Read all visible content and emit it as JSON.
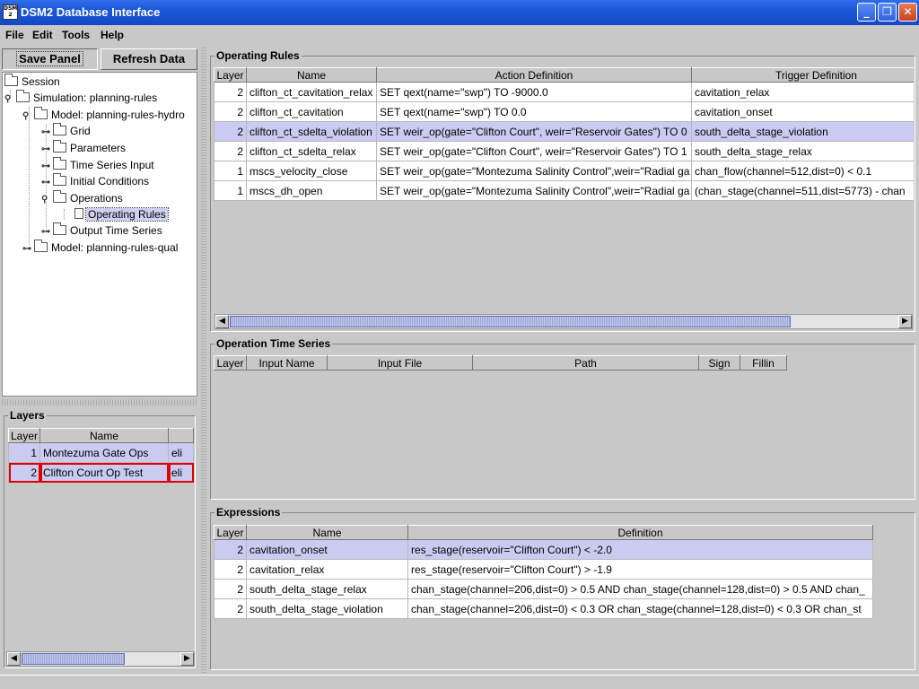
{
  "window": {
    "title": "DSM2 Database Interface",
    "icon_text": "DSM 2"
  },
  "menu": [
    "File",
    "Edit",
    "Tools",
    "Help"
  ],
  "toolbar": {
    "save_label": "Save Panel",
    "refresh_label": "Refresh Data"
  },
  "tree": {
    "session": "Session",
    "simulation": "Simulation: planning-rules",
    "model_hydro": "Model: planning-rules-hydro",
    "grid": "Grid",
    "parameters": "Parameters",
    "time_series_input": "Time Series Input",
    "initial_conditions": "Initial Conditions",
    "operations": "Operations",
    "operating_rules": "Operating Rules",
    "output_time_series": "Output Time Series",
    "model_qual": "Model: planning-rules-qual"
  },
  "layers": {
    "title": "Layers",
    "columns": [
      "Layer",
      "Name",
      ""
    ],
    "rows": [
      {
        "layer": "1",
        "name": "Montezuma Gate Ops",
        "extra": "eli"
      },
      {
        "layer": "2",
        "name": "Clifton Court Op Test",
        "extra": "eli"
      }
    ]
  },
  "operating_rules": {
    "title": "Operating Rules",
    "columns": [
      "Layer",
      "Name",
      "Action Definition",
      "Trigger Definition"
    ],
    "rows": [
      {
        "layer": "2",
        "name": "clifton_ct_cavitation_relax",
        "action": "SET qext(name=\"swp\") TO -9000.0",
        "trigger": "cavitation_relax"
      },
      {
        "layer": "2",
        "name": "clifton_ct_cavitation",
        "action": "SET qext(name=\"swp\") TO 0.0",
        "trigger": "cavitation_onset"
      },
      {
        "layer": "2",
        "name": "clifton_ct_sdelta_violation",
        "action": "SET weir_op(gate=\"Clifton Court\", weir=\"Reservoir Gates\") TO 0",
        "trigger": "south_delta_stage_violation"
      },
      {
        "layer": "2",
        "name": "clifton_ct_sdelta_relax",
        "action": "SET weir_op(gate=\"Clifton Court\", weir=\"Reservoir Gates\") TO 1",
        "trigger": "south_delta_stage_relax"
      },
      {
        "layer": "1",
        "name": "mscs_velocity_close",
        "action": "SET weir_op(gate=\"Montezuma Salinity Control\",weir=\"Radial ga",
        "trigger": "chan_flow(channel=512,dist=0) < 0.1"
      },
      {
        "layer": "1",
        "name": "mscs_dh_open",
        "action": "SET weir_op(gate=\"Montezuma Salinity Control\",weir=\"Radial ga",
        "trigger": "(chan_stage(channel=511,dist=5773) - chan"
      }
    ]
  },
  "operation_time_series": {
    "title": "Operation Time Series",
    "columns": [
      "Layer",
      "Input Name",
      "Input File",
      "Path",
      "Sign",
      "Fillin"
    ]
  },
  "expressions": {
    "title": "Expressions",
    "columns": [
      "Layer",
      "Name",
      "Definition"
    ],
    "rows": [
      {
        "layer": "2",
        "name": "cavitation_onset",
        "definition": "res_stage(reservoir=\"Clifton Court\") < -2.0"
      },
      {
        "layer": "2",
        "name": "cavitation_relax",
        "definition": "res_stage(reservoir=\"Clifton Court\") > -1.9"
      },
      {
        "layer": "2",
        "name": "south_delta_stage_relax",
        "definition": "chan_stage(channel=206,dist=0) > 0.5 AND chan_stage(channel=128,dist=0) > 0.5 AND chan_"
      },
      {
        "layer": "2",
        "name": "south_delta_stage_violation",
        "definition": "chan_stage(channel=206,dist=0) < 0.3 OR chan_stage(channel=128,dist=0) < 0.3 OR chan_st"
      }
    ]
  }
}
